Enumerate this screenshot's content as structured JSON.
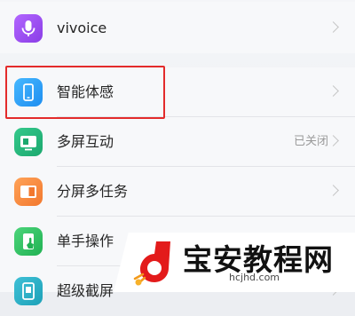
{
  "settings": {
    "items": [
      {
        "label": "vivoice",
        "icon": "microphone-icon"
      },
      {
        "label": "智能体感",
        "icon": "phone-motion-icon"
      },
      {
        "label": "多屏互动",
        "icon": "multiscreen-icon",
        "status": "已关闭"
      },
      {
        "label": "分屏多任务",
        "icon": "split-screen-icon"
      },
      {
        "label": "单手操作",
        "icon": "one-hand-icon"
      },
      {
        "label": "超级截屏",
        "icon": "screenshot-icon"
      }
    ]
  },
  "watermark": {
    "title": "宝安教程网",
    "url": "hcjhd.com"
  },
  "colors": {
    "highlight": "#e32b2b",
    "text": "#262626",
    "status": "#9a9a9a",
    "background": "#eceef2"
  }
}
